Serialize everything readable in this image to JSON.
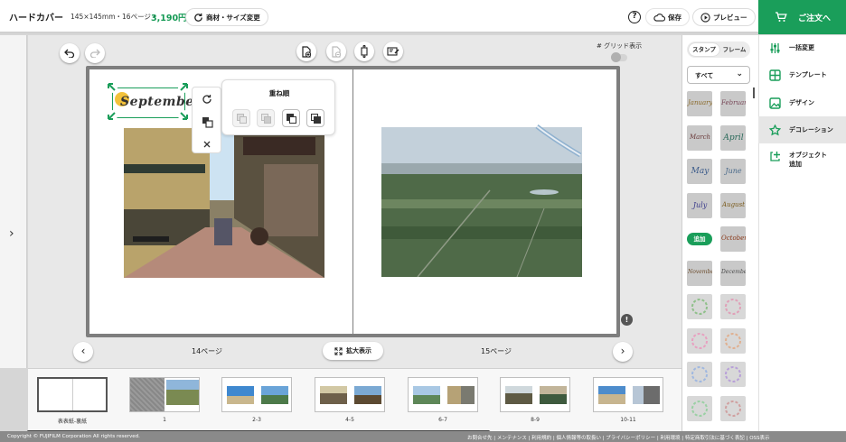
{
  "header": {
    "product": "ハードカバー",
    "spec": "145×145mm・16ページ・",
    "price": "3,190円",
    "change_label": "商材・サイズ変更",
    "help_glyph": "?",
    "save_label": "保存",
    "preview_label": "プレビュー",
    "order_label": "ご注文へ"
  },
  "toolbar": {
    "grid_label": "# グリッド表示"
  },
  "popover": {
    "title": "重ね順"
  },
  "editor": {
    "sticker_text": "September",
    "left_page_label": "14ページ",
    "right_page_label": "15ページ",
    "zoom_label": "拡大表示",
    "warning_glyph": "!"
  },
  "filmstrip": {
    "labels": [
      "表表紙-裏紙",
      "1",
      "2-3",
      "4-5",
      "6-7",
      "8-9",
      "10-11"
    ]
  },
  "stamps": {
    "tabs": [
      "スタンプ",
      "フレーム"
    ],
    "filter": "すべて",
    "add_badge": "追加",
    "months": [
      "January",
      "February",
      "March",
      "April",
      "May",
      "June",
      "July",
      "August",
      "September",
      "October",
      "November",
      "December"
    ]
  },
  "menu": {
    "items": [
      "一括変更",
      "テンプレート",
      "デザイン",
      "デコレーション",
      "オブジェクト追加"
    ]
  },
  "footer": {
    "copyright": "Copyright © FUJIFILM Corporation All rights reserved.",
    "links": "お問合せ先 | メンテナンス | 利用規約 | 個人情報等の取扱い | プライバシーポリシー | 利用環境 | 特定商取引法に基づく表記 | OSS表示"
  },
  "colors": {
    "accent": "#1a9e5a",
    "price": "#149a54"
  }
}
